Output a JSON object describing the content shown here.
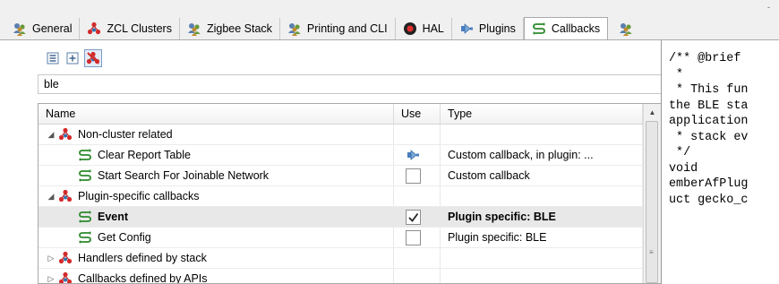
{
  "tabs": [
    {
      "label": "General",
      "icon": "people-icon",
      "active": false
    },
    {
      "label": "ZCL Clusters",
      "icon": "cluster-icon",
      "active": false
    },
    {
      "label": "Zigbee Stack",
      "icon": "people-icon",
      "active": false
    },
    {
      "label": "Printing and CLI",
      "icon": "people-icon",
      "active": false
    },
    {
      "label": "HAL",
      "icon": "record-icon",
      "active": false
    },
    {
      "label": "Plugins",
      "icon": "plugin-icon",
      "active": false
    },
    {
      "label": "Callbacks",
      "icon": "callback-icon",
      "active": true
    }
  ],
  "corner_mark": "-",
  "filter": {
    "value": "ble"
  },
  "table": {
    "columns": {
      "name": "Name",
      "use": "Use",
      "type": "Type"
    },
    "rows": [
      {
        "level": 0,
        "expanded": true,
        "icon": "cluster-icon",
        "name": "Non-cluster related",
        "use": null,
        "type": "",
        "bold": false
      },
      {
        "level": 1,
        "icon": "callback-icon",
        "name": "Clear Report Table",
        "use": "plugin-icon",
        "type": "Custom callback, in plugin: ...",
        "bold": false
      },
      {
        "level": 1,
        "icon": "callback-icon",
        "name": "Start Search For Joinable Network",
        "use": "unchecked",
        "type": "Custom callback",
        "bold": false
      },
      {
        "level": 0,
        "expanded": true,
        "icon": "cluster-icon",
        "name": "Plugin-specific callbacks",
        "use": null,
        "type": "",
        "bold": false
      },
      {
        "level": 1,
        "icon": "callback-icon",
        "name": "Event",
        "use": "checked",
        "type": "Plugin specific: BLE",
        "bold": true,
        "selected": true
      },
      {
        "level": 1,
        "icon": "callback-icon",
        "name": "Get Config",
        "use": "unchecked",
        "type": "Plugin specific: BLE",
        "bold": false
      },
      {
        "level": 0,
        "expanded": false,
        "icon": "cluster-icon",
        "name": "Handlers defined by stack",
        "use": null,
        "type": "",
        "bold": false
      },
      {
        "level": 0,
        "expanded": false,
        "icon": "cluster-icon",
        "name": "Callbacks defined by APIs",
        "use": null,
        "type": "",
        "bold": false
      }
    ]
  },
  "code_lines": [
    "/** @brief",
    " *",
    " * This fun",
    "the BLE sta",
    "application",
    " * stack ev",
    " */",
    "void",
    "emberAfPlug",
    "uct gecko_c"
  ],
  "colors": {
    "accent_red": "#d42a2a",
    "green": "#2b8a2b",
    "selected_row": "#e8e8e8"
  }
}
